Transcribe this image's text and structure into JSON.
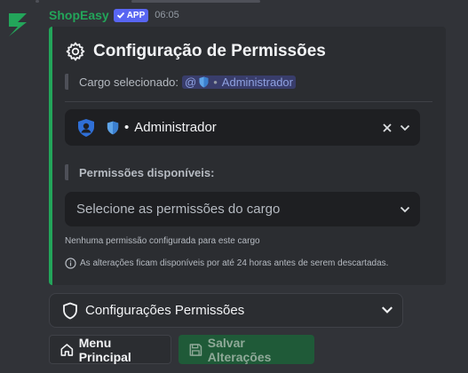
{
  "message": {
    "bot_name": "ShopEasy",
    "app_badge": "APP",
    "timestamp": "06:05"
  },
  "embed": {
    "title": "Configuração de Permissões",
    "cargo_label": "Cargo selecionado:",
    "cargo_mention_prefix": "@",
    "cargo_mention_sep": "•",
    "cargo_mention_name": "Administrador",
    "role_select": {
      "sep": "•",
      "value": "Administrador"
    },
    "perms_label": "Permissões disponíveis:",
    "perms_select": {
      "placeholder": "Selecione as permissões do cargo"
    },
    "empty_note": "Nenhuma permissão configurada para este cargo",
    "info_note": "As alterações ficam disponíveis por até 24 horas antes de serem descartadas.",
    "accent_color": "#23a55a"
  },
  "section_select": {
    "label": "Configurações Permissões"
  },
  "buttons": {
    "menu_label": "Menu Principal",
    "save_label": "Salvar Alterações"
  }
}
